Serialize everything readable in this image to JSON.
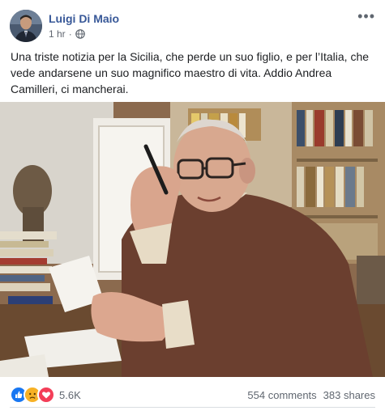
{
  "post": {
    "author": "Luigi Di Maio",
    "time": "1 hr",
    "separator": "·",
    "privacy_icon": "globe-icon",
    "menu_label": "•••",
    "text": "Una triste notizia per la Sicilia, che perde un suo figlio, e per l’Italia, che vede andarsene un suo magnifico maestro di vita. Addio Andrea Camilleri, ci mancherai."
  },
  "footer": {
    "reaction_icons": [
      "like-icon",
      "sad-icon",
      "love-icon"
    ],
    "reaction_count": "5.6K",
    "comments": "554 comments",
    "shares": "383 shares"
  },
  "colors": {
    "name_link": "#385898",
    "meta_text": "#606770",
    "like_blue": "#1877f2",
    "love_red": "#f33e58",
    "sad_yellow": "#f7b125"
  }
}
